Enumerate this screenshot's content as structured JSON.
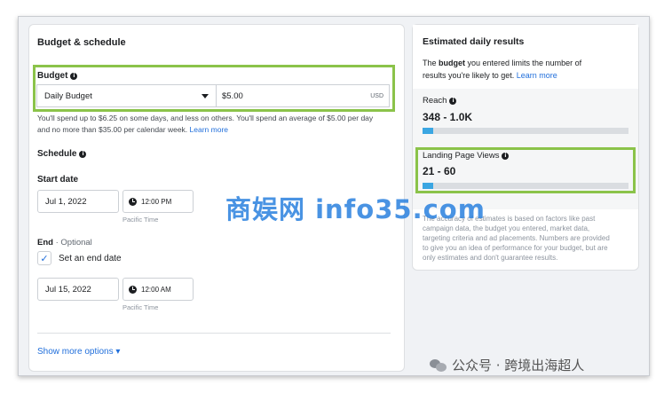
{
  "budget_schedule": {
    "title": "Budget & schedule",
    "budget_label": "Budget",
    "budget_type": "Daily Budget",
    "budget_amount": "$5.00",
    "currency": "USD",
    "help_line1": "You'll spend up to $6.25 on some days, and less on others. You'll spend an average of $5.00 per day",
    "help_line2": "and no more than $35.00 per calendar week.",
    "help_link": "Learn more",
    "schedule_label": "Schedule",
    "start_label": "Start date",
    "start_date": "Jul 1, 2022",
    "start_time": "12:00 PM",
    "timezone": "Pacific Time",
    "end_label": "End",
    "end_optional": "· Optional",
    "set_end_label": "Set an end date",
    "end_date": "Jul 15, 2022",
    "end_time": "12:00 AM",
    "end_timezone": "Pacific Time",
    "show_more": "Show more options ▾"
  },
  "estimated": {
    "title": "Estimated daily results",
    "desc_pre": "The ",
    "desc_bold": "budget",
    "desc_post": " you entered limits the number of",
    "desc_line2": "results you're likely to get.",
    "desc_link": "Learn more",
    "reach_label": "Reach",
    "reach_value": "348 - 1.0K",
    "reach_fill_fraction": 0.05,
    "lpv_label": "Landing Page Views",
    "lpv_value": "21 - 60",
    "lpv_fill_fraction": 0.05,
    "disclaimer": [
      "The accuracy of estimates is based on factors like past",
      "campaign data, the budget you entered, market data,",
      "targeting criteria and ad placements. Numbers are provided",
      "to give you an idea of performance for your budget, but are",
      "only estimates and don't guarantee results."
    ]
  },
  "watermark": "商娱网 info35.com",
  "wechat_mark": "公众号 · 跨境出海超人",
  "colors": {
    "highlight": "#8bc34a",
    "link": "#216fdb",
    "bar": "#3ba6e2"
  },
  "icons": [
    "info-icon",
    "chevron-down-icon",
    "clock-icon",
    "checkmark-icon",
    "wechat-icon"
  ]
}
